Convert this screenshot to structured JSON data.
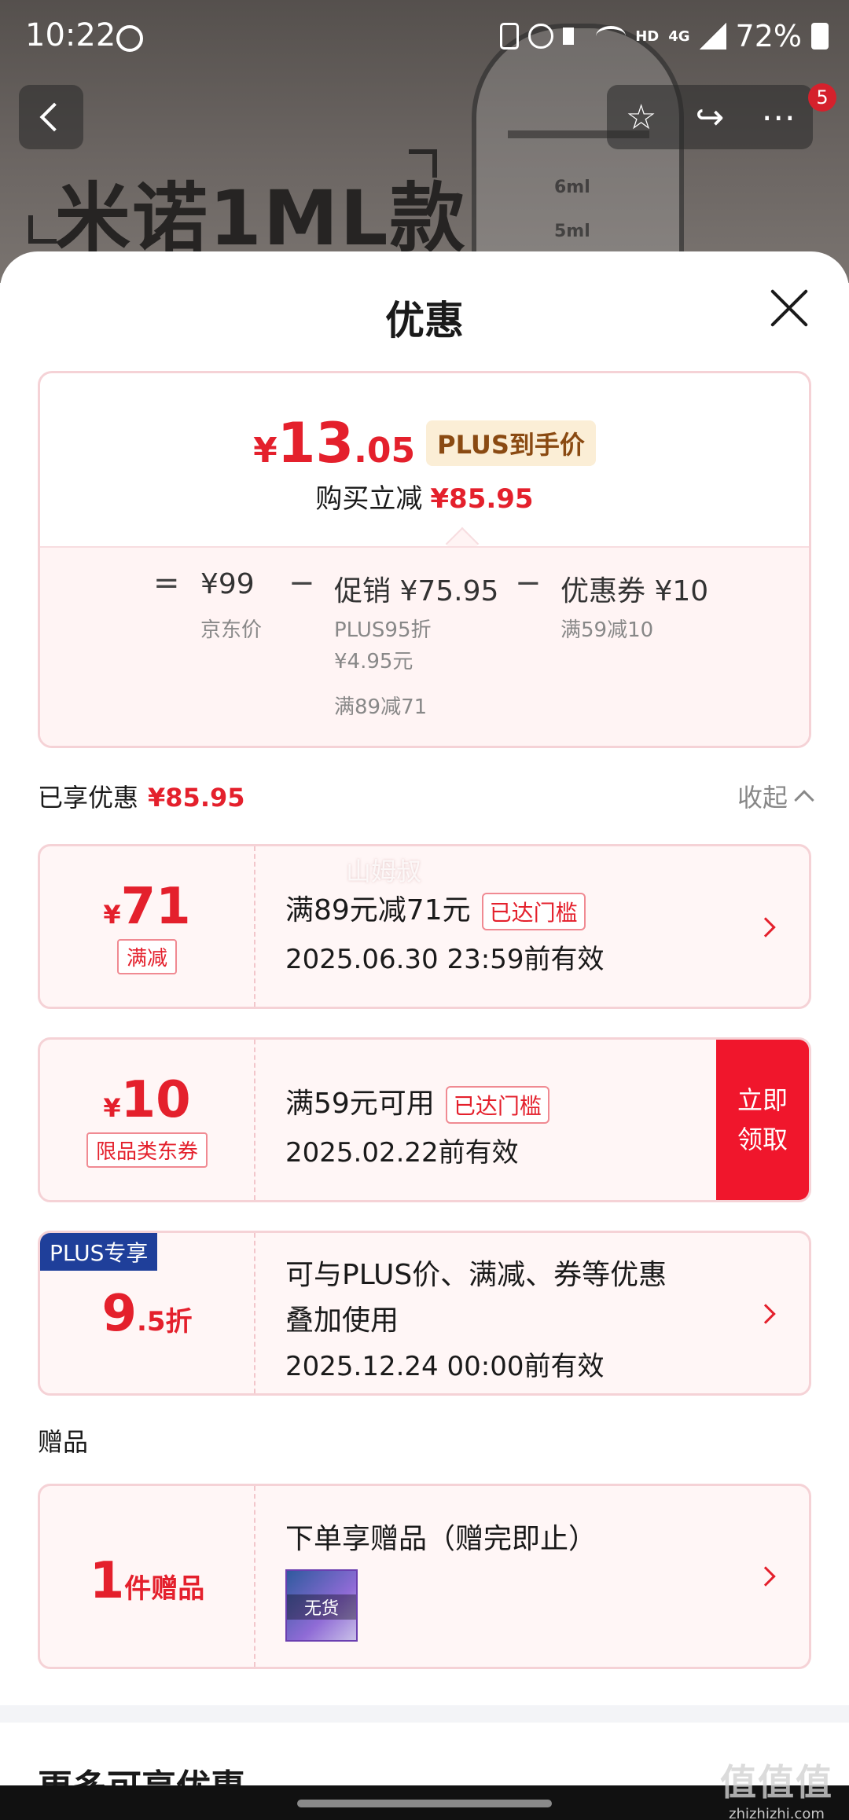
{
  "status_bar": {
    "time": "10:22",
    "hd": "HD",
    "network": "4G",
    "battery": "72%"
  },
  "backdrop": {
    "product_title": "米诺1ML款",
    "mark_6ml": "6ml",
    "mark_5ml": "5ml"
  },
  "nav": {
    "badge_count": "5",
    "star": "☆",
    "share": "↪",
    "more": "⋯"
  },
  "sheet": {
    "title": "优惠"
  },
  "summary": {
    "currency": "¥",
    "price_int": "13",
    "price_dec": ".05",
    "plus_tag": "PLUS到手价",
    "cut_label": "购买立减",
    "cut_value": "¥85.95",
    "eq": "=",
    "minus": "−",
    "base_price": "¥99",
    "base_label": "京东价",
    "promo_main": "促销 ¥75.95",
    "promo_sub1": "PLUS95折",
    "promo_sub2": "¥4.95元",
    "promo_sub3": "满89减71",
    "coupon_main": "优惠券 ¥10",
    "coupon_sub": "满59减10"
  },
  "enjoyed": {
    "label": "已享优惠",
    "value": "¥85.95",
    "collapse": "收起"
  },
  "cards": [
    {
      "sym": "¥",
      "amount": "71",
      "tag": "满减",
      "title": "满89元减71元",
      "reached": "已达门槛",
      "validity": "2025.06.30 23:59前有效"
    },
    {
      "sym": "¥",
      "amount": "10",
      "tag": "限品类东券",
      "title": "满59元可用",
      "reached": "已达门槛",
      "validity": "2025.02.22前有效",
      "claim_line1": "立即",
      "claim_line2": "领取"
    },
    {
      "corner": "PLUS专享",
      "amount": "9",
      "amount_small": ".5折",
      "line1": "可与PLUS价、满减、券等优惠",
      "line2": "叠加使用",
      "validity": "2025.12.24 00:00前有效"
    }
  ],
  "gifts": {
    "section": "赠品",
    "count": "1",
    "unit": "件赠品",
    "title": "下单享赠品（赠完即止）",
    "out_of_stock": "无货"
  },
  "more": {
    "title": "更多可享优惠"
  },
  "overlays": {
    "watermark": "山姆叔",
    "site_big": "值值值",
    "site_small": "zhizhizhi.com"
  }
}
